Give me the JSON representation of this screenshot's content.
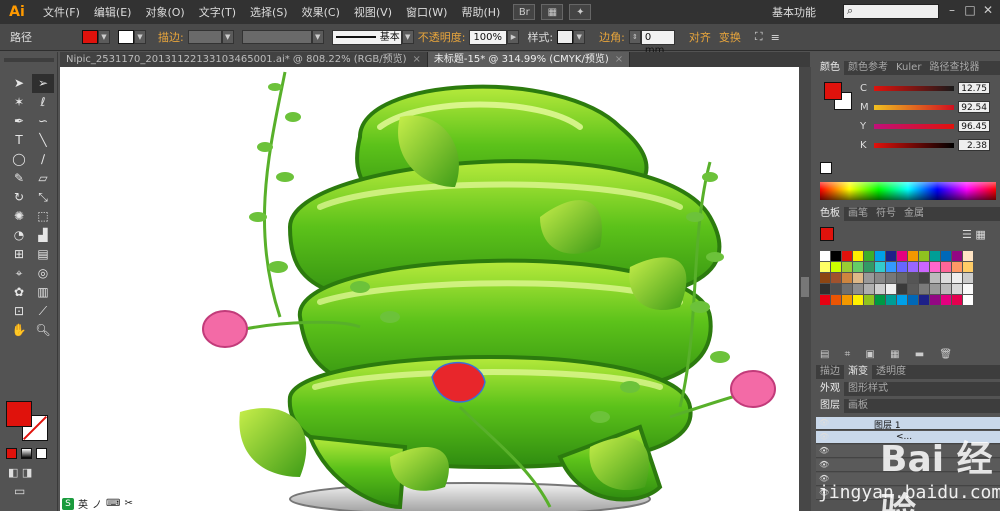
{
  "app": {
    "logo": "Ai"
  },
  "menu": [
    "文件(F)",
    "编辑(E)",
    "对象(O)",
    "文字(T)",
    "选择(S)",
    "效果(C)",
    "视图(V)",
    "窗口(W)",
    "帮助(H)"
  ],
  "workspace_label": "基本功能",
  "control": {
    "selection_label": "路径",
    "stroke_label": "描边:",
    "stroke_style": "基本",
    "opacity_label": "不透明度:",
    "opacity_value": "100%",
    "style_label": "样式:",
    "corner_label": "边角:",
    "corner_value": "0 mm",
    "align_label": "对齐",
    "transform_label": "变换"
  },
  "doc_tabs": [
    {
      "label": "Nipic_2531170_20131122133103465001.ai* @ 808.22% (RGB/预览)",
      "active": false
    },
    {
      "label": "未标题-15* @ 314.99% (CMYK/预览)",
      "active": true
    }
  ],
  "colors": {
    "fill": "#e0120c",
    "stroke": "#ffffff",
    "accent_orange": "#e8a53c"
  },
  "panels": {
    "color_tabs": [
      "颜色",
      "颜色参考",
      "Kuler",
      "路径查找器"
    ],
    "cmyk": [
      {
        "label": "C",
        "value": "12.75"
      },
      {
        "label": "M",
        "value": "92.54"
      },
      {
        "label": "Y",
        "value": "96.45"
      },
      {
        "label": "K",
        "value": "2.38"
      }
    ],
    "swatch_tabs": [
      "色板",
      "画笔",
      "符号",
      "金属"
    ],
    "stroke_tabs": [
      "描边",
      "渐变",
      "透明度"
    ],
    "appearance_tabs": [
      "外观",
      "图形样式"
    ],
    "layer_tabs": [
      "图层",
      "画板"
    ],
    "layers": [
      {
        "name": "图层 1",
        "selected": true
      },
      {
        "name": "<...",
        "selected": true
      },
      {
        "name": "",
        "selected": false
      },
      {
        "name": "",
        "selected": false
      },
      {
        "name": "",
        "selected": false
      },
      {
        "name": "",
        "selected": false
      }
    ]
  },
  "watermark": {
    "text": "Bai 经验",
    "url": "jingyan.baidu.com"
  },
  "ime": {
    "label": "英"
  }
}
